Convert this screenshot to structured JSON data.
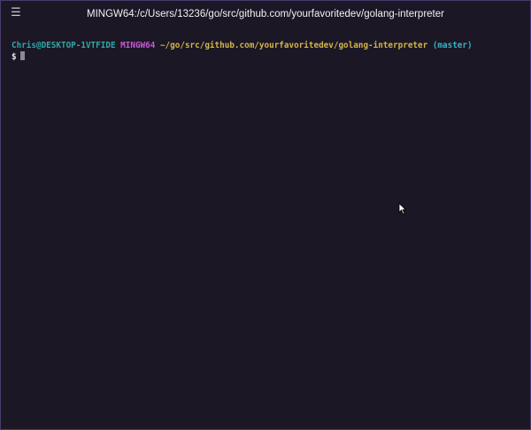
{
  "window": {
    "title": "MINGW64:/c/Users/13236/go/src/github.com/yourfavoritedev/golang-interpreter",
    "menu_icon": "hamburger-menu-icon"
  },
  "terminal": {
    "prompt_user": "Chris@DESKTOP-1VTFIDE",
    "prompt_system": "MINGW64",
    "prompt_path": "~/go/src/github.com/yourfavoritedev/golang-interpreter",
    "prompt_branch": "(master)",
    "prompt_symbol": "$"
  },
  "colors": {
    "background": "#1b1724",
    "user": "#2fa8a8",
    "system": "#c35bd6",
    "path": "#d6b54a",
    "branch": "#38b3c6"
  }
}
